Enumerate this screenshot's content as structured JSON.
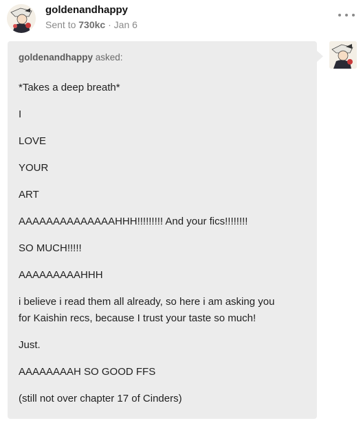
{
  "post": {
    "username": "goldenandhappy",
    "sent_to_prefix": "Sent to ",
    "sent_to_blog": "730kc",
    "date_sep": " · ",
    "date": "Jan 6"
  },
  "ask": {
    "asker": "goldenandhappy",
    "asked_suffix": " asked:",
    "paragraphs": [
      "*Takes a deep breath*",
      "I",
      "LOVE",
      "YOUR",
      "ART",
      "AAAAAAAAAAAAAAHHH!!!!!!!!! And your fics!!!!!!!!",
      "SO MUCH!!!!!",
      "AAAAAAAAAHHH",
      "i believe i read them all already, so here i am asking you",
      "for Kaishin recs, because I trust your taste so much!",
      "Just.",
      "AAAAAAAAH SO GOOD FFS",
      "(still not over chapter 17 of Cinders)"
    ]
  },
  "colors": {
    "ask_bg": "#ececec",
    "muted_text": "#8a8a8a"
  },
  "icons": {
    "more": "more-horizontal-icon",
    "avatar": "avatar-image"
  }
}
